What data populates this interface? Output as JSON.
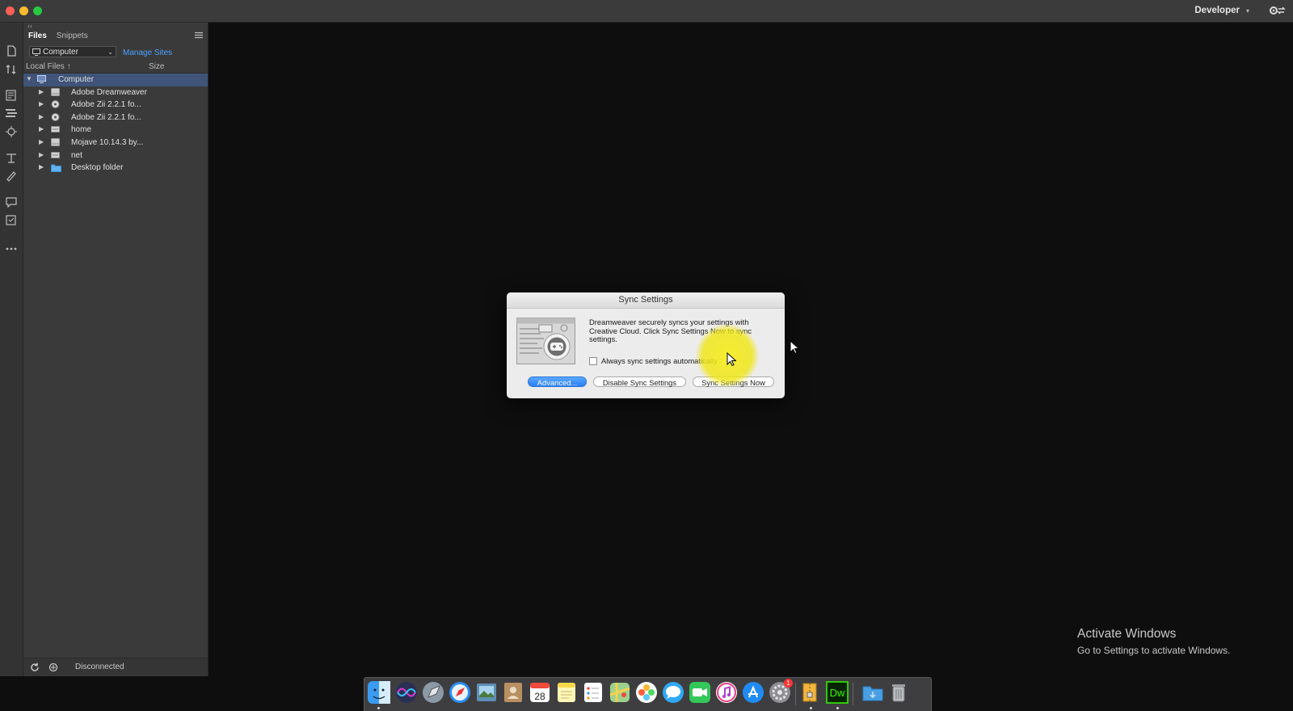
{
  "titlebar": {
    "workspace_label": "Developer"
  },
  "files_panel": {
    "tabs": [
      {
        "label": "Files"
      },
      {
        "label": "Snippets"
      }
    ],
    "site_select_value": "Computer",
    "manage_sites_label": "Manage Sites",
    "columns": {
      "name": "Local Files",
      "size": "Size"
    },
    "tree": [
      {
        "label": "Computer"
      },
      {
        "label": "Adobe Dreamweaver"
      },
      {
        "label": "Adobe Zii 2.2.1  fo..."
      },
      {
        "label": "Adobe Zii 2.2.1  fo..."
      },
      {
        "label": "home"
      },
      {
        "label": "Mojave 10.14.3 by..."
      },
      {
        "label": "net"
      },
      {
        "label": "Desktop folder"
      }
    ],
    "status": "Disconnected"
  },
  "dialog": {
    "title": "Sync Settings",
    "message": "Dreamweaver securely syncs your settings with Creative Cloud. Click Sync Settings Now to sync settings.",
    "checkbox_label": "Always sync settings automatically",
    "checkbox_checked": false,
    "buttons": {
      "advanced": "Advanced...",
      "disable": "Disable Sync Settings",
      "sync_now": "Sync Settings Now"
    }
  },
  "watermark": {
    "title": "Activate Windows",
    "subtitle": "Go to Settings to activate Windows."
  },
  "dock": {
    "calendar_day": "28",
    "dreamweaver_label": "Dw",
    "badge_count": "1"
  },
  "colors": {
    "accent_link": "#4aa3ff",
    "selection": "#3f5478",
    "primary_button": "#2a7ff4",
    "highlight": "#f6ee1e",
    "dreamweaver_green": "#35fa00"
  }
}
